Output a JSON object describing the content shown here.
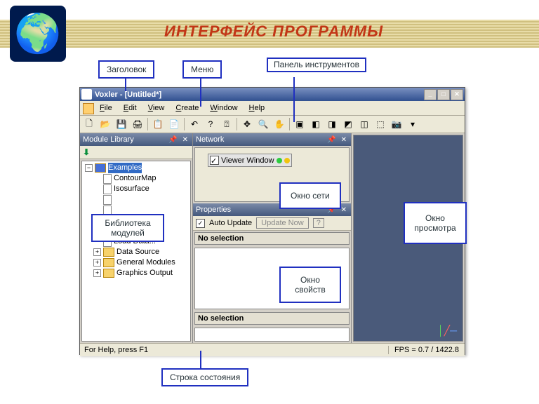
{
  "slide": {
    "title": "ИНТЕРФЕЙС  ПРОГРАММЫ"
  },
  "callouts": {
    "titlebar": "Заголовок",
    "menu": "Меню",
    "toolbar": "Панель инструментов",
    "library": "Библиотека модулей",
    "network": "Окно сети",
    "props": "Окно свойств",
    "viewer": "Окно просмотра",
    "status": "Строка состояния"
  },
  "app": {
    "title": "Voxler - [Untitled*]",
    "menus": [
      "File",
      "Edit",
      "View",
      "Create",
      "Window",
      "Help"
    ],
    "panes": {
      "library": "Module Library",
      "network": "Network",
      "properties": "Properties"
    },
    "tree": {
      "root": "Examples",
      "items": [
        "ContourMap",
        "Isosurface",
        "",
        "",
        "Load Data...",
        "Data Source",
        "General Modules",
        "Graphics Output"
      ]
    },
    "network_node": "Viewer Window",
    "props_auto": "Auto Update",
    "props_update": "Update Now",
    "nosel": "No selection",
    "status_left": "For Help, press F1",
    "status_right": "FPS = 0.7 / 1422.8"
  }
}
